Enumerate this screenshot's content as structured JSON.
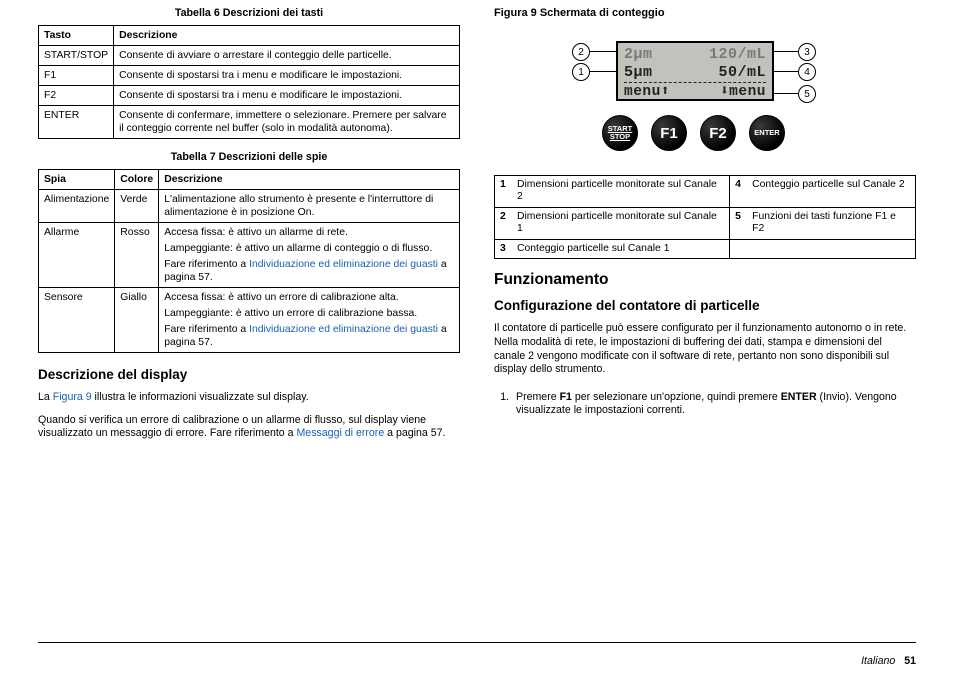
{
  "left": {
    "table6": {
      "caption": "Tabella 6  Descrizioni dei tasti",
      "head": {
        "c1": "Tasto",
        "c2": "Descrizione"
      },
      "rows": [
        {
          "key": "START/STOP",
          "desc": "Consente di avviare o arrestare il conteggio delle particelle."
        },
        {
          "key": "F1",
          "desc": "Consente di spostarsi tra i menu e modificare le impostazioni."
        },
        {
          "key": "F2",
          "desc": "Consente di spostarsi tra i menu e modificare le impostazioni."
        },
        {
          "key": "ENTER",
          "desc": "Consente di confermare, immettere o selezionare. Premere per salvare il conteggio corrente nel buffer (solo in modalità autonoma)."
        }
      ]
    },
    "table7": {
      "caption": "Tabella 7  Descrizioni delle spie",
      "head": {
        "c1": "Spia",
        "c2": "Colore",
        "c3": "Descrizione"
      },
      "rows": {
        "r0": {
          "spia": "Alimentazione",
          "colore": "Verde",
          "desc": "L'alimentazione allo strumento è presente e l'interruttore di alimentazione è in posizione On."
        },
        "r1": {
          "spia": "Allarme",
          "colore": "Rosso",
          "a": "Accesa fissa: è attivo un allarme di rete.",
          "b": "Lampeggiante: è attivo un allarme di conteggio o di flusso.",
          "c_pre": "Fare riferimento a ",
          "c_link": "Individuazione ed eliminazione dei guasti",
          "c_post": " a pagina 57."
        },
        "r2": {
          "spia": "Sensore",
          "colore": "Giallo",
          "a": "Accesa fissa: è attivo un errore di calibrazione alta.",
          "b": "Lampeggiante: è attivo un errore di calibrazione bassa.",
          "c_pre": "Fare riferimento a ",
          "c_link": "Individuazione ed eliminazione dei guasti",
          "c_post": " a pagina 57."
        }
      }
    },
    "display": {
      "heading": "Descrizione del display",
      "p1_pre": "La ",
      "p1_link": "Figura 9",
      "p1_post": " illustra le informazioni visualizzate sul display.",
      "p2_a": "Quando si verifica un errore di calibrazione o un allarme di flusso, sul display viene visualizzato un messaggio di errore. Fare riferimento a ",
      "p2_link": "Messaggi di errore",
      "p2_b": " a pagina 57."
    }
  },
  "right": {
    "fig": {
      "caption": "Figura 9  Schermata di conteggio",
      "lcd": {
        "r1l": "2µm",
        "r1r": "120/mL",
        "r2l": "5µm",
        "r2r": "50/mL",
        "menuL": "menu⬆",
        "menuR": "⬇menu"
      },
      "buttons": {
        "startstop_l1": "START",
        "startstop_l2": "STOP",
        "f1": "F1",
        "f2": "F2",
        "enter": "ENTER"
      },
      "call": {
        "c1": "1",
        "c2": "2",
        "c3": "3",
        "c4": "4",
        "c5": "5"
      }
    },
    "key": {
      "r1n": "1",
      "r1t": "Dimensioni particelle monitorate sul Canale 2",
      "r4n": "4",
      "r4t": "Conteggio particelle sul Canale 2",
      "r2n": "2",
      "r2t": "Dimensioni particelle monitorate sul Canale 1",
      "r5n": "5",
      "r5t": "Funzioni dei tasti funzione F1 e F2",
      "r3n": "3",
      "r3t": "Conteggio particelle sul Canale 1"
    },
    "op": {
      "h1": "Funzionamento",
      "h2": "Configurazione del contatore di particelle",
      "p": "Il contatore di particelle può essere configurato per il funzionamento autonomo o in rete. Nella modalità di rete, le impostazioni di buffering dei dati, stampa e dimensioni del canale 2 vengono modificate con il software di rete, pertanto non sono disponibili sul display dello strumento.",
      "step_a": "Premere ",
      "step_b": "F1",
      "step_c": " per selezionare un'opzione, quindi premere ",
      "step_d": "ENTER",
      "step_e": " (Invio). Vengono visualizzate le impostazioni correnti."
    }
  },
  "footer": {
    "lang": "Italiano",
    "page": "51"
  }
}
